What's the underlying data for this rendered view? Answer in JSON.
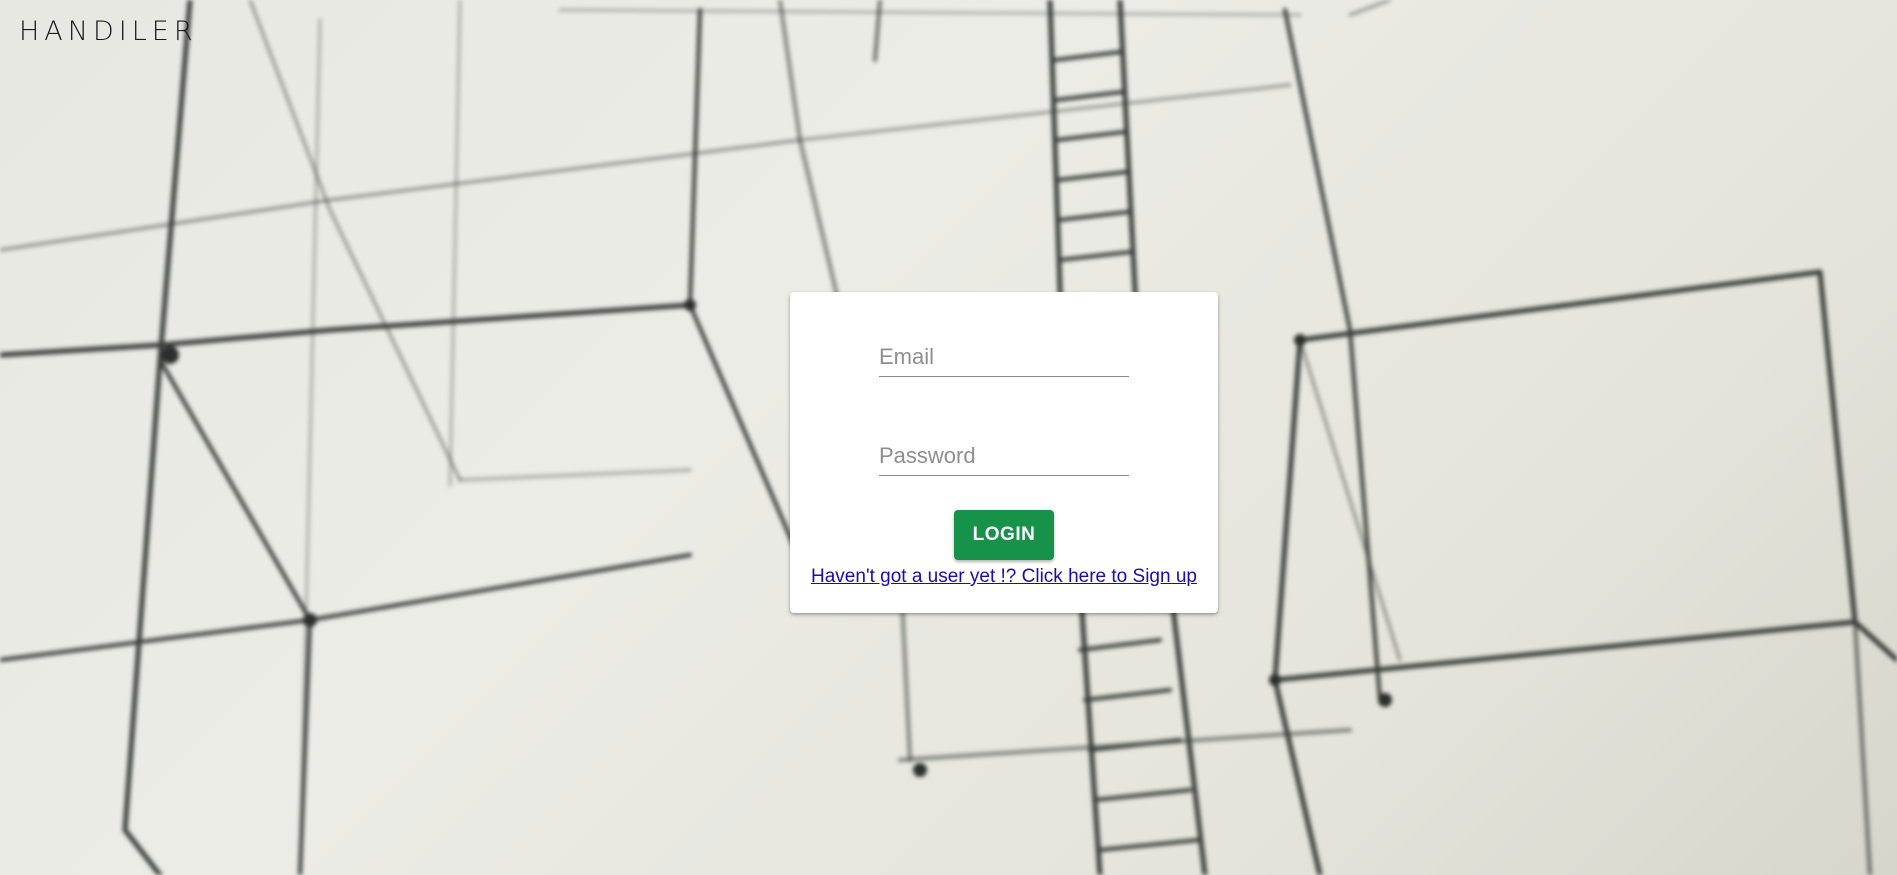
{
  "brand": {
    "name": "HANDILER"
  },
  "login": {
    "email_placeholder": "Email",
    "email_value": "",
    "password_placeholder": "Password",
    "password_value": "",
    "submit_label": "LOGIN",
    "signup_link_text": "Haven't got a user yet !? Click here to Sign up"
  },
  "colors": {
    "button": "#16924a",
    "link": "#1a0dab",
    "background": "#e8e8e2"
  }
}
